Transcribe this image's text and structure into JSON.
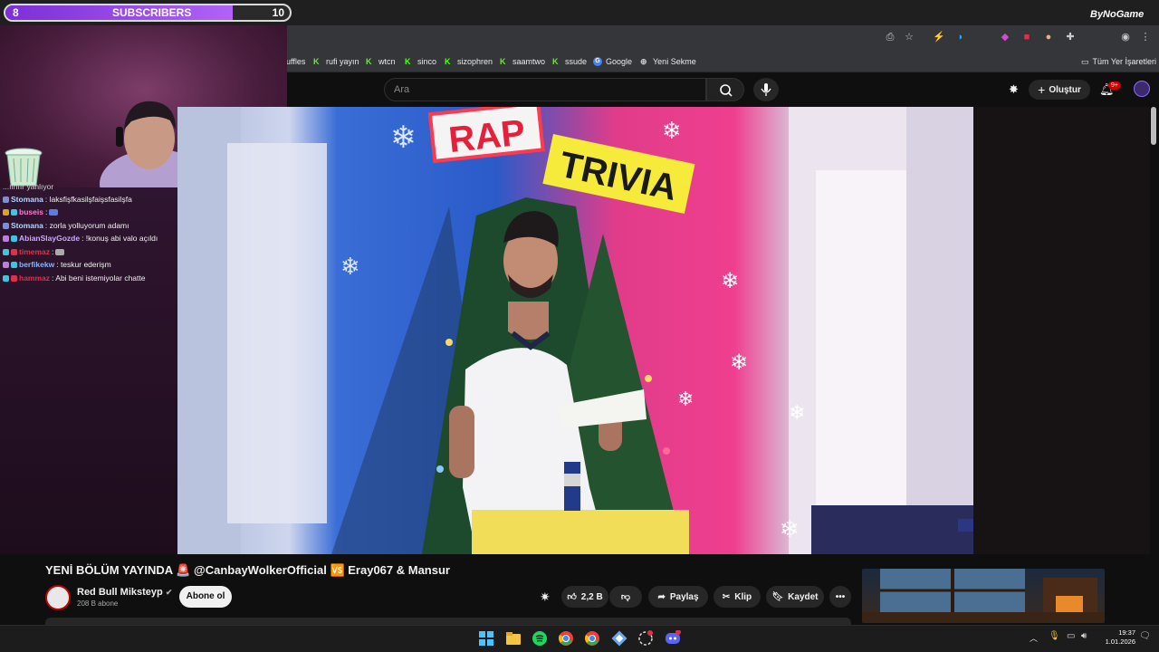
{
  "sub_goal": {
    "current": "8",
    "label": "SUBSCRIBERS",
    "target": "10",
    "progress": 0.8
  },
  "bookmarks": [
    {
      "label": "uffles",
      "icon": "kick-icon"
    },
    {
      "label": "rufi yayın",
      "icon": "kick-icon"
    },
    {
      "label": "wtcn",
      "icon": "kick-icon"
    },
    {
      "label": "sinco",
      "icon": "kick-icon"
    },
    {
      "label": "sizophren",
      "icon": "kick-icon"
    },
    {
      "label": "saamtwo",
      "icon": "kick-icon"
    },
    {
      "label": "ssude",
      "icon": "kick-icon"
    },
    {
      "label": "Google",
      "icon": "google-icon"
    },
    {
      "label": "Yeni Sekme",
      "icon": "globe-icon"
    }
  ],
  "bookmarks_all": "Tüm Yer İşaretleri",
  "watermark": "ByNoGame",
  "youtube": {
    "search_placeholder": "Ara",
    "create_label": "Oluştur",
    "notifications": "9+"
  },
  "chat": [
    {
      "user": "",
      "text": "...ıınıır yanlıyor",
      "color": "#cfcfcf"
    },
    {
      "user": "Stomana",
      "text": ": laksfişfkasilşfaişsfasilşfa",
      "color": "#b4d6ff"
    },
    {
      "user": "buseis",
      "text": ":",
      "color": "#ff7ad0"
    },
    {
      "user": "Stomana",
      "text": ": zorla yolluyorum adamı",
      "color": "#b4d6ff"
    },
    {
      "user": "AbianSlayGozde",
      "text": ": !konuş abi valo açıldı",
      "color": "#c9a8ff"
    },
    {
      "user": "timemaz",
      "text": ":",
      "color": "#e0314b"
    },
    {
      "user": "berfikekw",
      "text": ": teskur ederişm",
      "color": "#8ab4ff"
    },
    {
      "user": "hammaz",
      "text": ": Abi beni istemiyolar chatte",
      "color": "#e0314b"
    }
  ],
  "video_overlay": {
    "rap": "RAP",
    "trivia": "TRIVIA"
  },
  "video": {
    "title": "YENİ BÖLÜM YAYINDA 🚨 @CanbayWolkerOfficial 🆚 Eray067 & Mansur",
    "channel": "Red Bull Miksteyp",
    "subscribers": "208 B abone",
    "subscribe_label": "Abone ol",
    "likes": "2,2 B",
    "share_label": "Paylaş",
    "clip_label": "Klip",
    "save_label": "Kaydet"
  },
  "clock": {
    "time": "19:37",
    "date": "1.01.2026"
  }
}
